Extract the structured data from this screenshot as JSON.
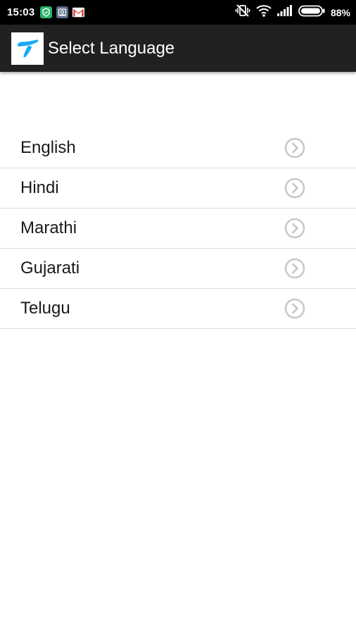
{
  "status_bar": {
    "time": "15:03",
    "notification_icons": [
      "shield-icon",
      "photo-icon",
      "gmail-icon"
    ],
    "system_icons": [
      "vibrate-off-icon",
      "wifi-icon",
      "signal-icon",
      "battery-icon"
    ],
    "battery_percent": "88%"
  },
  "action_bar": {
    "title": "Select Language",
    "logo_icon": "telenor-logo-icon",
    "logo_color": "#19aaf8",
    "background": "#212121"
  },
  "languages": {
    "items": [
      {
        "label": "English",
        "icon": "chevron-right-circle-icon"
      },
      {
        "label": "Hindi",
        "icon": "chevron-right-circle-icon"
      },
      {
        "label": "Marathi",
        "icon": "chevron-right-circle-icon"
      },
      {
        "label": "Gujarati",
        "icon": "chevron-right-circle-icon"
      },
      {
        "label": "Telugu",
        "icon": "chevron-right-circle-icon"
      }
    ]
  }
}
